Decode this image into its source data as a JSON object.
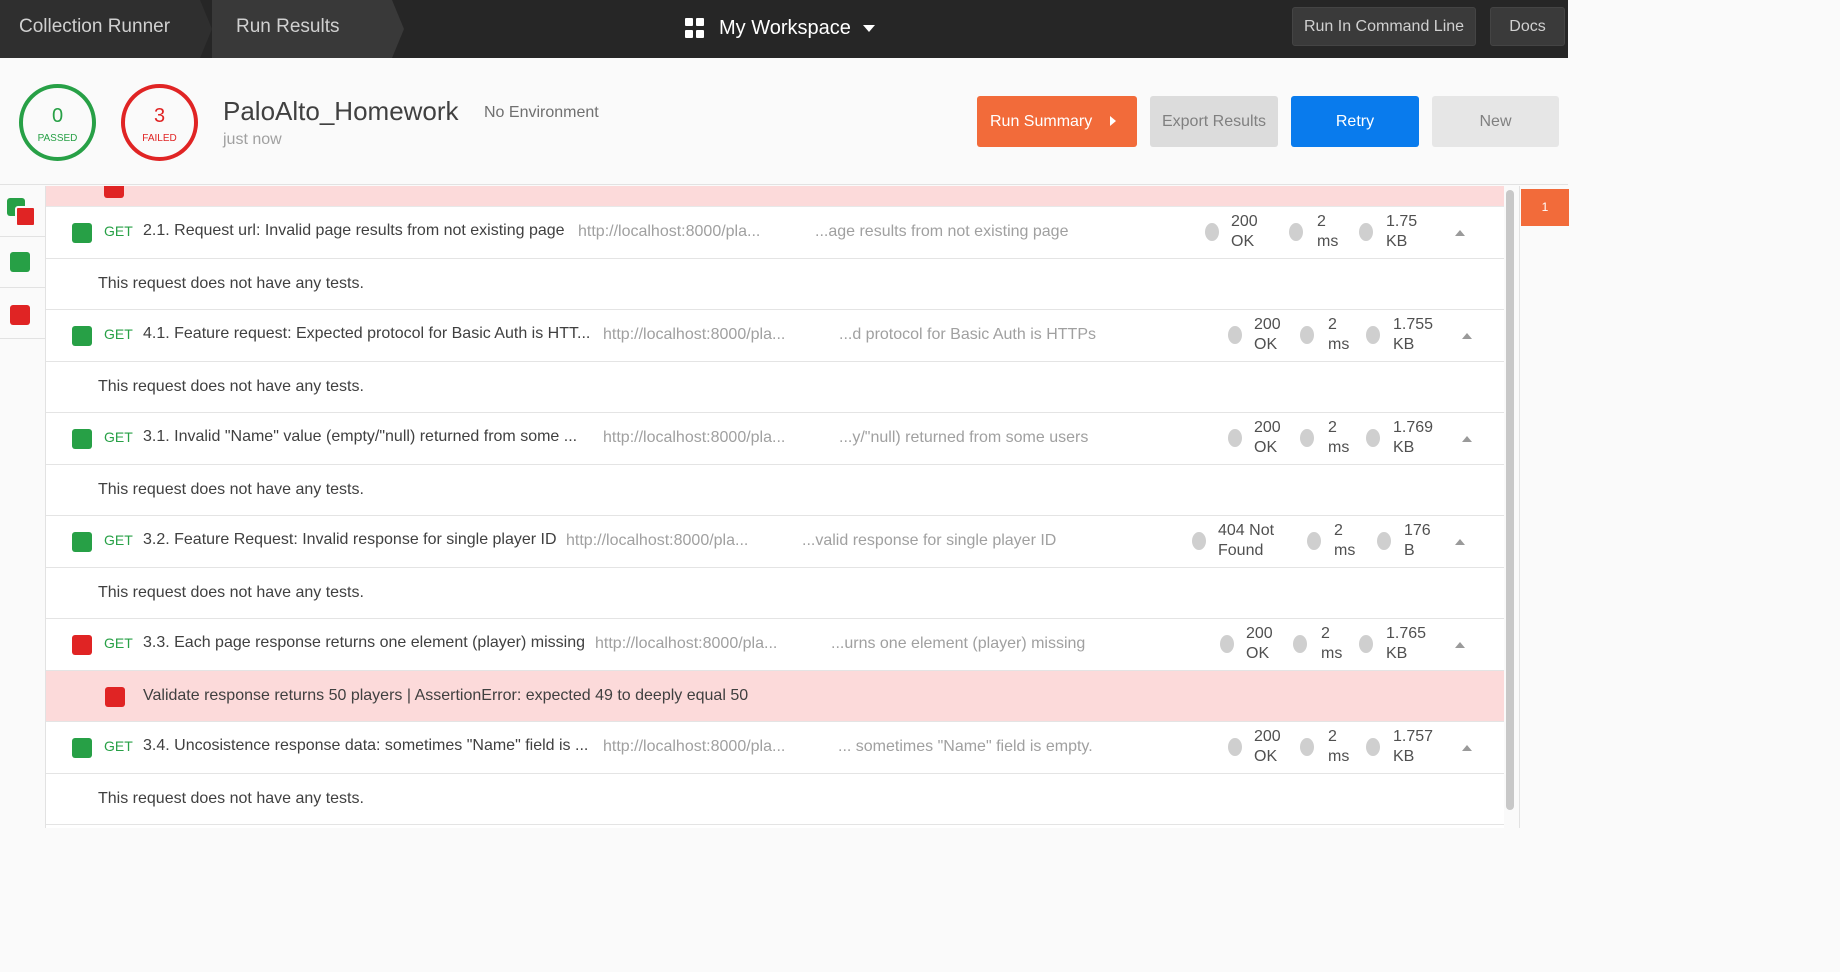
{
  "topbar": {
    "breadcrumb": [
      "Collection Runner",
      "Run Results"
    ],
    "workspace": "My Workspace",
    "run_in_command_line": "Run In Command Line",
    "docs": "Docs"
  },
  "summary": {
    "passed_count": "0",
    "passed_label": "PASSED",
    "failed_count": "3",
    "failed_label": "FAILED",
    "collection_name": "PaloAlto_Homework",
    "environment": "No Environment",
    "time": "just now",
    "buttons": {
      "run_summary": "Run Summary",
      "export": "Export Results",
      "retry": "Retry",
      "new": "New"
    }
  },
  "colors": {
    "pass": "#27a046",
    "fail": "#e02424",
    "accent_orange": "#f26b3a",
    "accent_blue": "#097bed",
    "fail_row_bg": "#fcdada"
  },
  "requests": [
    {
      "status": "pass",
      "method": "GET",
      "name": "2.1. Request url: Invalid page results from not existing page",
      "url": "http://localhost:8000/pla...",
      "desc": "...age results from not existing page",
      "code": [
        "200",
        "OK"
      ],
      "time": [
        "2",
        "ms"
      ],
      "size": [
        "1.75",
        "KB"
      ],
      "tests": "This request does not have any tests."
    },
    {
      "status": "pass",
      "method": "GET",
      "name": "4.1. Feature request: Expected protocol for Basic Auth is HTT...",
      "url": "http://localhost:8000/pla...",
      "desc": "...d protocol for Basic Auth is HTTPs",
      "code": [
        "200",
        "OK"
      ],
      "time": [
        "2",
        "ms"
      ],
      "size": [
        "1.755",
        "KB"
      ],
      "tests": "This request does not have any tests."
    },
    {
      "status": "pass",
      "method": "GET",
      "name": "3.1. Invalid \"Name\" value (empty/\"null) returned from some ...",
      "url": "http://localhost:8000/pla...",
      "desc": "...y/\"null) returned from some users",
      "code": [
        "200",
        "OK"
      ],
      "time": [
        "2",
        "ms"
      ],
      "size": [
        "1.769",
        "KB"
      ],
      "tests": "This request does not have any tests."
    },
    {
      "status": "pass",
      "method": "GET",
      "name": "3.2. Feature Request: Invalid response for single player ID",
      "url": "http://localhost:8000/pla...",
      "desc": "...valid response for single player ID",
      "code": [
        "404 Not",
        "Found"
      ],
      "time": [
        "2",
        "ms"
      ],
      "size": [
        "176",
        "B"
      ],
      "tests": "This request does not have any tests."
    },
    {
      "status": "fail",
      "method": "GET",
      "name": "3.3. Each page response returns one element (player) missing",
      "url": "http://localhost:8000/pla...",
      "desc": "...urns one element (player) missing",
      "code": [
        "200",
        "OK"
      ],
      "time": [
        "2",
        "ms"
      ],
      "size": [
        "1.765",
        "KB"
      ],
      "tests": "Validate response returns 50 players | AssertionError: expected 49 to deeply equal 50"
    },
    {
      "status": "pass",
      "method": "GET",
      "name": "3.4. Uncosistence response data: sometimes \"Name\" field is ...",
      "url": "http://localhost:8000/pla...",
      "desc": "... sometimes \"Name\" field is empty.",
      "code": [
        "200",
        "OK"
      ],
      "time": [
        "2",
        "ms"
      ],
      "size": [
        "1.757",
        "KB"
      ],
      "tests": "This request does not have any tests."
    }
  ],
  "right_panel": {
    "fail_marker": "1"
  }
}
